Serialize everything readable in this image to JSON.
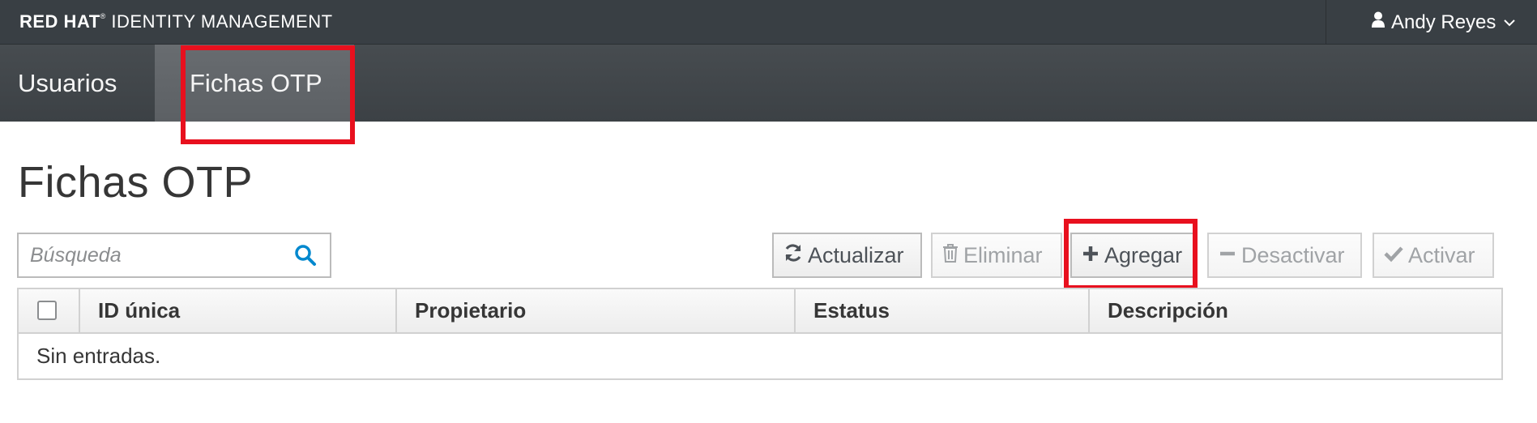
{
  "masthead": {
    "brand_bold": "RED HAT",
    "brand_tm": "®",
    "brand_rest": "IDENTITY MANAGEMENT",
    "user_name": "Andy Reyes"
  },
  "nav": {
    "tabs": [
      {
        "label": "Usuarios",
        "active": false
      },
      {
        "label": "Fichas OTP",
        "active": true
      }
    ]
  },
  "page": {
    "title": "Fichas OTP"
  },
  "search": {
    "placeholder": "Búsqueda",
    "value": ""
  },
  "toolbar": {
    "refresh_label": "Actualizar",
    "delete_label": "Eliminar",
    "add_label": "Agregar",
    "deactivate_label": "Desactivar",
    "activate_label": "Activar"
  },
  "table": {
    "columns": [
      "ID única",
      "Propietario",
      "Estatus",
      "Descripción"
    ],
    "rows": [],
    "empty_message": "Sin entradas."
  },
  "colors": {
    "masthead_bg": "#393f44",
    "highlight": "#e8101e",
    "search_icon": "#0088ce"
  }
}
